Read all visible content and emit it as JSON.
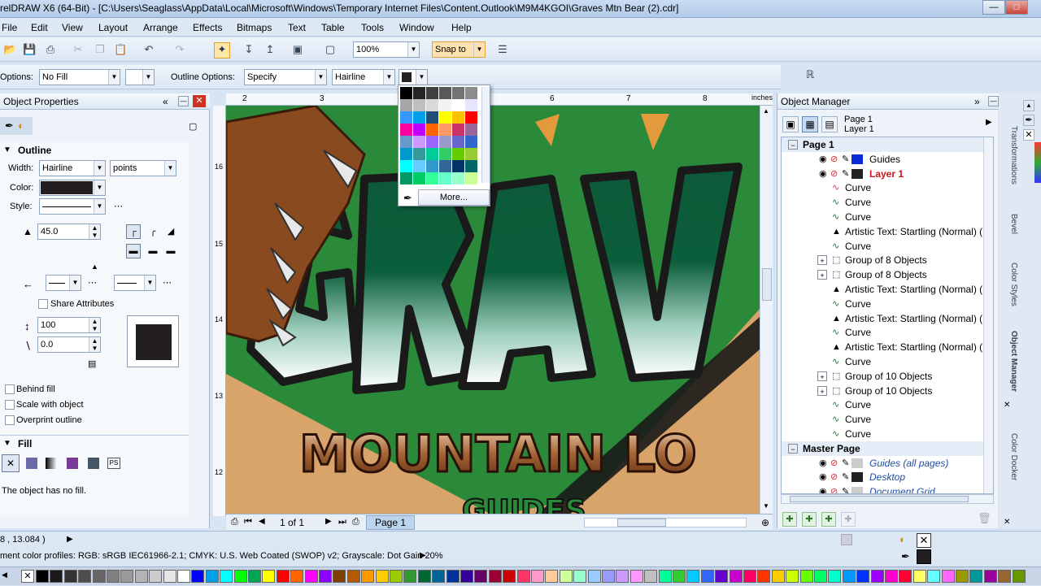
{
  "window": {
    "title": "relDRAW X6 (64-Bit) - [C:\\Users\\Seaglass\\AppData\\Local\\Microsoft\\Windows\\Temporary Internet Files\\Content.Outlook\\M9M4KGOI\\Graves Mtn Bear (2).cdr]"
  },
  "menu": [
    "File",
    "Edit",
    "View",
    "Layout",
    "Arrange",
    "Effects",
    "Bitmaps",
    "Text",
    "Table",
    "Tools",
    "Window",
    "Help"
  ],
  "toolbar1": {
    "zoom": "100%",
    "snap": "Snap to"
  },
  "toolbar2": {
    "fill_label": "Options:",
    "fill_value": "No Fill",
    "outline_label": "Outline Options:",
    "outline_value": "Specify",
    "width_value": "Hairline"
  },
  "color_popup": {
    "more": "More..."
  },
  "object_properties": {
    "title": "Object Properties",
    "outline_title": "Outline",
    "width_label": "Width:",
    "width_value": "Hairline",
    "units": "points",
    "color_label": "Color:",
    "style_label": "Style:",
    "miter": "45.0",
    "share_attributes": "Share Attributes",
    "stretch": "100",
    "angle": "0.0",
    "behind_fill": "Behind fill",
    "scale_with_object": "Scale with object",
    "overprint_outline": "Overprint outline",
    "fill_title": "Fill",
    "fill_none": "The object has no fill."
  },
  "ruler": {
    "unit": "inches",
    "h_ticks": [
      "2",
      "3",
      "6",
      "7",
      "8"
    ],
    "v_ticks": [
      "16",
      "15",
      "14",
      "13",
      "12"
    ]
  },
  "canvas": {
    "main_text": "GRAV",
    "sub_text": "MOUNTAIN LO"
  },
  "page_nav": {
    "count": "1 of 1",
    "tab": "Page 1"
  },
  "object_manager": {
    "title": "Object Manager",
    "page": "Page 1",
    "layer": "Layer 1",
    "tree": [
      {
        "label": "Page 1",
        "level": 0,
        "bold": true,
        "kind": "page"
      },
      {
        "label": "Guides",
        "level": 1,
        "kind": "layer",
        "color": "#0a2bd8"
      },
      {
        "label": "Layer 1",
        "level": 1,
        "kind": "layer",
        "color": "#222222",
        "red": true
      },
      {
        "label": "Curve",
        "level": 2,
        "kind": "curve"
      },
      {
        "label": "Curve",
        "level": 2,
        "kind": "curve"
      },
      {
        "label": "Curve",
        "level": 2,
        "kind": "curve"
      },
      {
        "label": "Artistic Text: Startling (Normal) (",
        "level": 2,
        "kind": "text"
      },
      {
        "label": "Curve",
        "level": 2,
        "kind": "curve"
      },
      {
        "label": "Group of 8 Objects",
        "level": 2,
        "kind": "group"
      },
      {
        "label": "Group of 8 Objects",
        "level": 2,
        "kind": "group"
      },
      {
        "label": "Artistic Text: Startling (Normal) (",
        "level": 2,
        "kind": "text"
      },
      {
        "label": "Curve",
        "level": 2,
        "kind": "curve"
      },
      {
        "label": "Artistic Text: Startling (Normal) (",
        "level": 2,
        "kind": "text"
      },
      {
        "label": "Curve",
        "level": 2,
        "kind": "curve"
      },
      {
        "label": "Artistic Text: Startling (Normal) (",
        "level": 2,
        "kind": "text"
      },
      {
        "label": "Curve",
        "level": 2,
        "kind": "curve"
      },
      {
        "label": "Group of 10 Objects",
        "level": 2,
        "kind": "group"
      },
      {
        "label": "Group of 10 Objects",
        "level": 2,
        "kind": "group"
      },
      {
        "label": "Curve",
        "level": 2,
        "kind": "curve"
      },
      {
        "label": "Curve",
        "level": 2,
        "kind": "curve"
      },
      {
        "label": "Curve",
        "level": 2,
        "kind": "curve"
      },
      {
        "label": "Master Page",
        "level": 0,
        "bold": true,
        "kind": "page"
      },
      {
        "label": "Guides (all pages)",
        "level": 1,
        "kind": "layer",
        "color": "#cccccc",
        "italic": true
      },
      {
        "label": "Desktop",
        "level": 1,
        "kind": "layer",
        "color": "#222222",
        "italic": true
      },
      {
        "label": "Document Grid",
        "level": 1,
        "kind": "layer",
        "color": "#cccccc",
        "italic": true
      }
    ]
  },
  "docker_tabs": [
    "Transformations",
    "Bevel",
    "Color Styles",
    "Object Manager",
    "Color Docker"
  ],
  "status": {
    "coords": "8 , 13.084 )",
    "profiles": "ment color profiles: RGB: sRGB IEC61966-2.1; CMYK: U.S. Web Coated (SWOP) v2; Grayscale: Dot Gain 20%"
  },
  "palette": [
    "#000000",
    "#1a1a1a",
    "#333333",
    "#4d4d4d",
    "#666666",
    "#808080",
    "#999999",
    "#b3b3b3",
    "#cccccc",
    "#e6e6e6",
    "#ffffff",
    "#0000ff",
    "#00a0e9",
    "#00ffff",
    "#00ff00",
    "#00a651",
    "#ffff00",
    "#ff0000",
    "#ff6600",
    "#ff00ff",
    "#8b00ff",
    "#7f3f00",
    "#b35900",
    "#ff9900",
    "#ffcc00",
    "#99cc00",
    "#339933",
    "#006633",
    "#006699",
    "#003399",
    "#330099",
    "#660066",
    "#990033",
    "#cc0000",
    "#ff3366",
    "#ff99cc",
    "#ffcc99",
    "#ccff99",
    "#99ffcc",
    "#99ccff",
    "#9999ff",
    "#cc99ff",
    "#ff99ff",
    "#c0c0c0",
    "#00ff99",
    "#33cc33",
    "#00ccff",
    "#3366ff",
    "#6600cc",
    "#cc00cc",
    "#ff0066",
    "#ff3300",
    "#ffcc00",
    "#ccff00",
    "#66ff00",
    "#00ff66",
    "#00ffcc",
    "#0099ff",
    "#0033ff",
    "#9900ff",
    "#ff00cc",
    "#ff0033",
    "#ffff66",
    "#66ffff",
    "#ff66ff",
    "#999900",
    "#009999",
    "#990099",
    "#996633",
    "#669900"
  ],
  "popup_colors": [
    "#000000",
    "#262626",
    "#404040",
    "#595959",
    "#737373",
    "#8c8c8c",
    "#a6a6a6",
    "#bfbfbf",
    "#d9d9d9",
    "#f2f2f2",
    "#ffffff",
    "#e6e6ff",
    "#3399ff",
    "#00a0e9",
    "#1f4e79",
    "#ffff00",
    "#ffc000",
    "#ff0000",
    "#ff00a0",
    "#c000ff",
    "#ff6600",
    "#ff9966",
    "#cc3366",
    "#996699",
    "#6699cc",
    "#cc99ff",
    "#9966ff",
    "#9999cc",
    "#6666cc",
    "#3366cc",
    "#0099cc",
    "#339999",
    "#00cc99",
    "#33cc66",
    "#66cc00",
    "#99cc33",
    "#00ffff",
    "#66ccff",
    "#3399cc",
    "#336699",
    "#003366",
    "#006666",
    "#009966",
    "#00cc66",
    "#33ff99",
    "#66ffcc",
    "#99ffcc",
    "#ccff99"
  ]
}
